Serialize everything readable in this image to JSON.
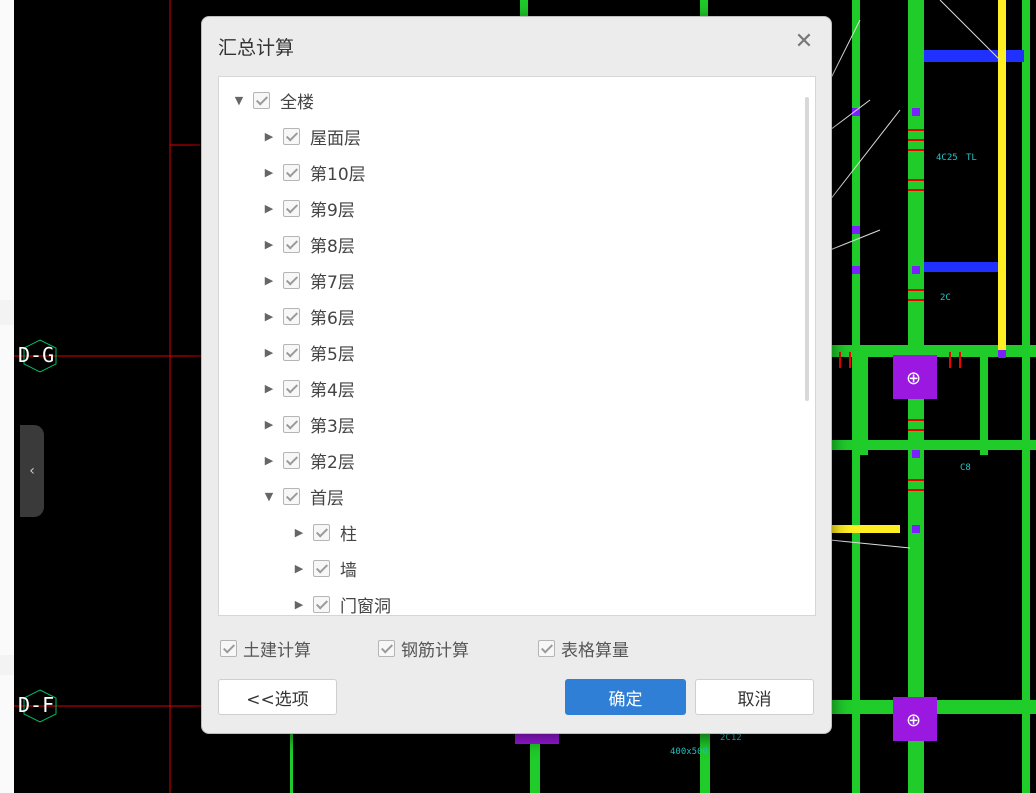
{
  "background": {
    "axis_labels": [
      "D-G",
      "D-F"
    ],
    "collapse_icon": "chevron-left-icon"
  },
  "dialog": {
    "title": "汇总计算",
    "close_icon": "close-icon",
    "tree": [
      {
        "label": "全楼",
        "level": 0,
        "expanded": true,
        "checked": true
      },
      {
        "label": "屋面层",
        "level": 1,
        "expanded": false,
        "checked": true
      },
      {
        "label": "第10层",
        "level": 1,
        "expanded": false,
        "checked": true
      },
      {
        "label": "第9层",
        "level": 1,
        "expanded": false,
        "checked": true
      },
      {
        "label": "第8层",
        "level": 1,
        "expanded": false,
        "checked": true
      },
      {
        "label": "第7层",
        "level": 1,
        "expanded": false,
        "checked": true
      },
      {
        "label": "第6层",
        "level": 1,
        "expanded": false,
        "checked": true
      },
      {
        "label": "第5层",
        "level": 1,
        "expanded": false,
        "checked": true
      },
      {
        "label": "第4层",
        "level": 1,
        "expanded": false,
        "checked": true
      },
      {
        "label": "第3层",
        "level": 1,
        "expanded": false,
        "checked": true
      },
      {
        "label": "第2层",
        "level": 1,
        "expanded": false,
        "checked": true
      },
      {
        "label": "首层",
        "level": 1,
        "expanded": true,
        "checked": true
      },
      {
        "label": "柱",
        "level": 2,
        "expanded": false,
        "checked": true
      },
      {
        "label": "墙",
        "level": 2,
        "expanded": false,
        "checked": true
      },
      {
        "label": "门窗洞",
        "level": 2,
        "expanded": false,
        "checked": true
      }
    ],
    "options": [
      {
        "label": "土建计算",
        "checked": true
      },
      {
        "label": "钢筋计算",
        "checked": true
      },
      {
        "label": "表格算量",
        "checked": true
      }
    ],
    "buttons": {
      "options_label": "<<选项",
      "ok_label": "确定",
      "cancel_label": "取消"
    },
    "colors": {
      "primary": "#2f7fd6"
    }
  }
}
